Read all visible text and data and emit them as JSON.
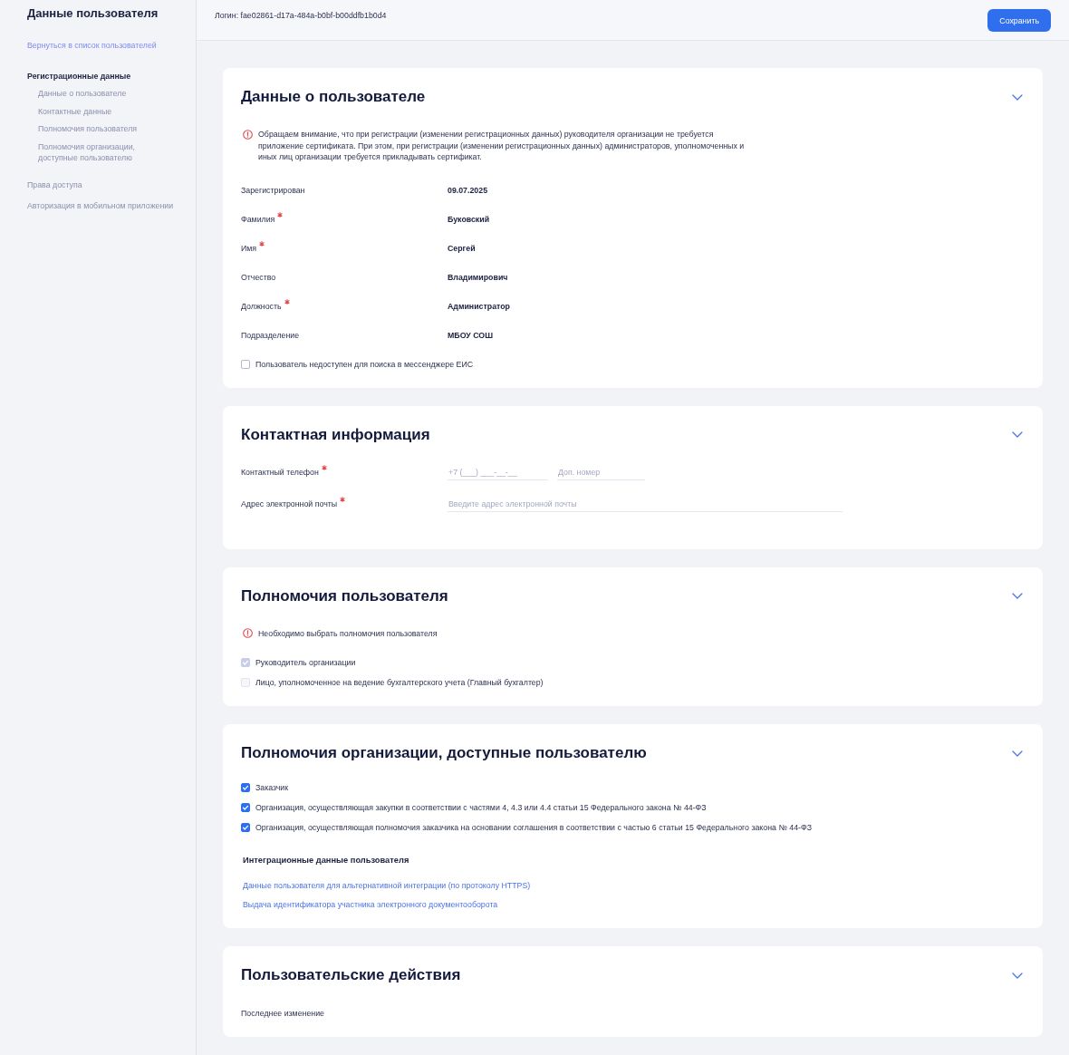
{
  "sidebar": {
    "title": "Данные пользователя",
    "back_link": "Вернуться в список пользователей",
    "items": [
      {
        "label": "Регистрационные данные",
        "selected": true,
        "children": [
          {
            "label": "Данные о пользователе",
            "selected": false
          },
          {
            "label": "Контактные данные",
            "selected": false
          },
          {
            "label": "Полномочия пользователя",
            "selected": false
          },
          {
            "label": "Полномочия организации, доступные пользователю",
            "selected": false
          }
        ]
      },
      {
        "label": "Права доступа",
        "selected": false
      },
      {
        "label": "Авторизация в мобильном приложении",
        "selected": false
      }
    ]
  },
  "header": {
    "login": "Логин: fae02861-d17a-484a-b0bf-b00ddfb1b0d4",
    "save_button": "Сохранить"
  },
  "sections": [
    {
      "title": "Данные о пользователе",
      "expanded": true,
      "notice": "Обращаем внимание, что при регистрации (изменении регистрационных данных) руководителя организации не требуется приложение сертификата. При этом, при регистрации (изменении регистрационных данных) администраторов, уполномоченных и иных лиц организации требуется прикладывать сертификат.",
      "fields": [
        {
          "label": "Зарегистрирован",
          "required": false,
          "value": "09.07.2025"
        },
        {
          "label": "Фамилия",
          "required": true,
          "value": "Буковский"
        },
        {
          "label": "Имя",
          "required": true,
          "value": "Сергей"
        },
        {
          "label": "Отчество",
          "required": false,
          "value": "Владимирович"
        },
        {
          "label": "Должность",
          "required": true,
          "value": "Администратор"
        },
        {
          "label": "Подразделение",
          "required": false,
          "value": "МБОУ СОШ"
        }
      ],
      "checkboxes": [
        {
          "label": "Пользователь недоступен для поиска в мессенджере ЕИС",
          "checked": false,
          "disabled": false
        }
      ]
    },
    {
      "title": "Контактная информация",
      "expanded": true,
      "inputs": [
        {
          "label": "Контактный телефон",
          "required": true,
          "fields": [
            {
              "kind": "phone",
              "placeholder": "+7 (___) ___-__-__"
            },
            {
              "kind": "extension",
              "placeholder": "Доп. номер"
            }
          ]
        },
        {
          "label": "Адрес электронной почты",
          "required": true,
          "fields": [
            {
              "kind": "email",
              "placeholder": "Введите адрес электронной почты"
            }
          ]
        }
      ]
    },
    {
      "title": "Полномочия пользователя",
      "expanded": true,
      "notice": "Необходимо выбрать полномочия пользователя",
      "checkboxes": [
        {
          "label": "Руководитель организации",
          "checked": true,
          "disabled": true
        },
        {
          "label": "Лицо, уполномоченное на ведение бухгалтерского учета (Главный бухгалтер)",
          "checked": false,
          "disabled": true
        }
      ]
    },
    {
      "title": "Полномочия организации, доступные пользователю",
      "expanded": true,
      "checkboxes": [
        {
          "label": "Заказчик",
          "checked": true,
          "disabled": false
        },
        {
          "label": "Организация, осуществляющая закупки в соответствии с частями 4, 4.3 или 4.4 статьи 15 Федерального закона № 44-ФЗ",
          "checked": true,
          "disabled": false
        },
        {
          "label": "Организация, осуществляющая полномочия заказчика на основании соглашения в соответствии с частью 6 статьи 15 Федерального закона № 44-ФЗ",
          "checked": true,
          "disabled": false
        }
      ],
      "subheading": "Интеграционные данные пользователя",
      "links": [
        "Данные пользователя для альтернативной интеграции (по протоколу HTTPS)",
        "Выдача идентификатора участника электронного документооборота"
      ]
    },
    {
      "title": "Пользовательские действия",
      "expanded": true,
      "fields": [
        {
          "label": "Последнее изменение",
          "required": false
        }
      ]
    }
  ]
}
